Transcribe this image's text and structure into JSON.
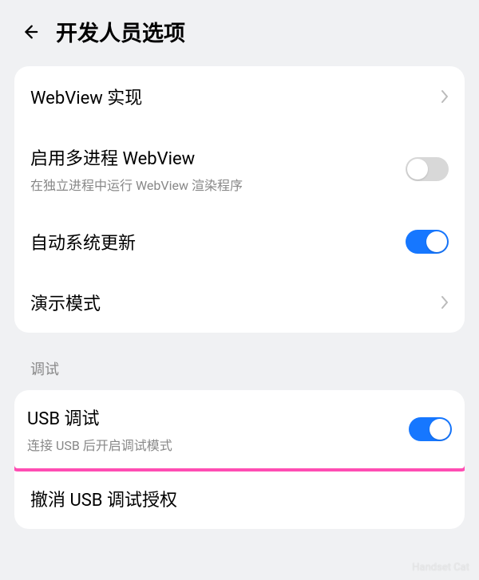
{
  "header": {
    "title": "开发人员选项"
  },
  "group1": {
    "webview_impl": {
      "title": "WebView 实现"
    },
    "multi_process_webview": {
      "title": "启用多进程 WebView",
      "subtitle": "在独立进程中运行 WebView 渲染程序",
      "enabled": false
    },
    "auto_system_update": {
      "title": "自动系统更新",
      "enabled": true
    },
    "demo_mode": {
      "title": "演示模式"
    }
  },
  "section_debug": {
    "label": "调试"
  },
  "group2": {
    "usb_debug": {
      "title": "USB 调试",
      "subtitle": "连接 USB 后开启调试模式",
      "enabled": true
    },
    "revoke_usb_auth": {
      "title": "撤消 USB 调试授权"
    }
  },
  "watermark": "Handset Cat"
}
